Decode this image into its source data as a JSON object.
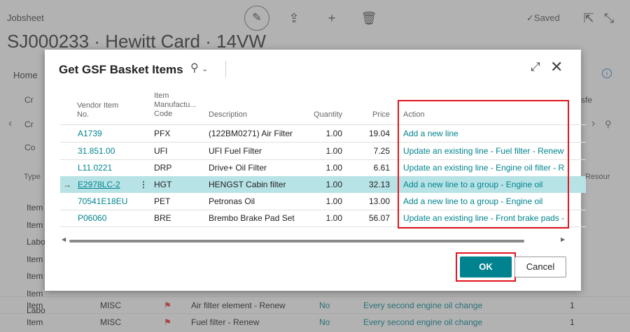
{
  "background": {
    "page_label": "Jobsheet",
    "record_title": "SJ000233 · Hewitt Card · 14VW",
    "saved_label": "Saved",
    "home_tab": "Home",
    "action_stubs": [
      "Cr",
      "Cr",
      "Co"
    ],
    "side_stub": "sfe",
    "grid_head_type": "Type",
    "grid_head_resource": "Resour",
    "left_column_rows": [
      "Item",
      "Item",
      "Labo",
      "Item",
      "Item",
      "Item",
      "Labo"
    ],
    "bottom_rows": [
      {
        "type": "Item",
        "code": "MISC",
        "description": "Air filter element - Renew",
        "flag": "No",
        "interval": "Every second engine oil change",
        "qty": "1"
      },
      {
        "type": "Item",
        "code": "MISC",
        "description": "Fuel filter - Renew",
        "flag": "No",
        "interval": "Every second engine oil change",
        "qty": "1"
      }
    ]
  },
  "dialog": {
    "title": "Get GSF Basket Items",
    "columns": {
      "vendor_item": [
        "Vendor Item",
        "No."
      ],
      "manufacturer": [
        "Item",
        "Manufactu...",
        "Code"
      ],
      "description": "Description",
      "quantity": "Quantity",
      "price": "Price",
      "action": "Action"
    },
    "rows": [
      {
        "vendor_item": "A1739",
        "code": "PFX",
        "description": "(122BM0271) Air Filter",
        "quantity": "1.00",
        "price": "19.04",
        "action": "Add a new line",
        "selected": false
      },
      {
        "vendor_item": "31.851.00",
        "code": "UFI",
        "description": "UFI Fuel Filter",
        "quantity": "1.00",
        "price": "7.25",
        "action": "Update an existing line - Fuel filter - Renew",
        "selected": false
      },
      {
        "vendor_item": "L11.0221",
        "code": "DRP",
        "description": "Drive+ Oil Filter",
        "quantity": "1.00",
        "price": "6.61",
        "action": "Update an existing line - Engine oil filter - R",
        "selected": false
      },
      {
        "vendor_item": "E2978LC-2",
        "code": "HGT",
        "description": "HENGST Cabin filter",
        "quantity": "1.00",
        "price": "32.13",
        "action": "Add a new line to a group - Engine oil",
        "selected": true
      },
      {
        "vendor_item": "70541E18EU",
        "code": "PET",
        "description": "Petronas Oil",
        "quantity": "1.00",
        "price": "13.00",
        "action": "Add a new line to a group - Engine oil",
        "selected": false
      },
      {
        "vendor_item": "P06060",
        "code": "BRE",
        "description": "Brembo Brake Pad Set",
        "quantity": "1.00",
        "price": "56.07",
        "action": "Update an existing line - Front brake pads -",
        "selected": false
      }
    ],
    "ok_label": "OK",
    "cancel_label": "Cancel"
  },
  "colors": {
    "accent": "#00838f",
    "selected_row": "#b8e3e6",
    "highlight_frame": "#e0141d"
  }
}
